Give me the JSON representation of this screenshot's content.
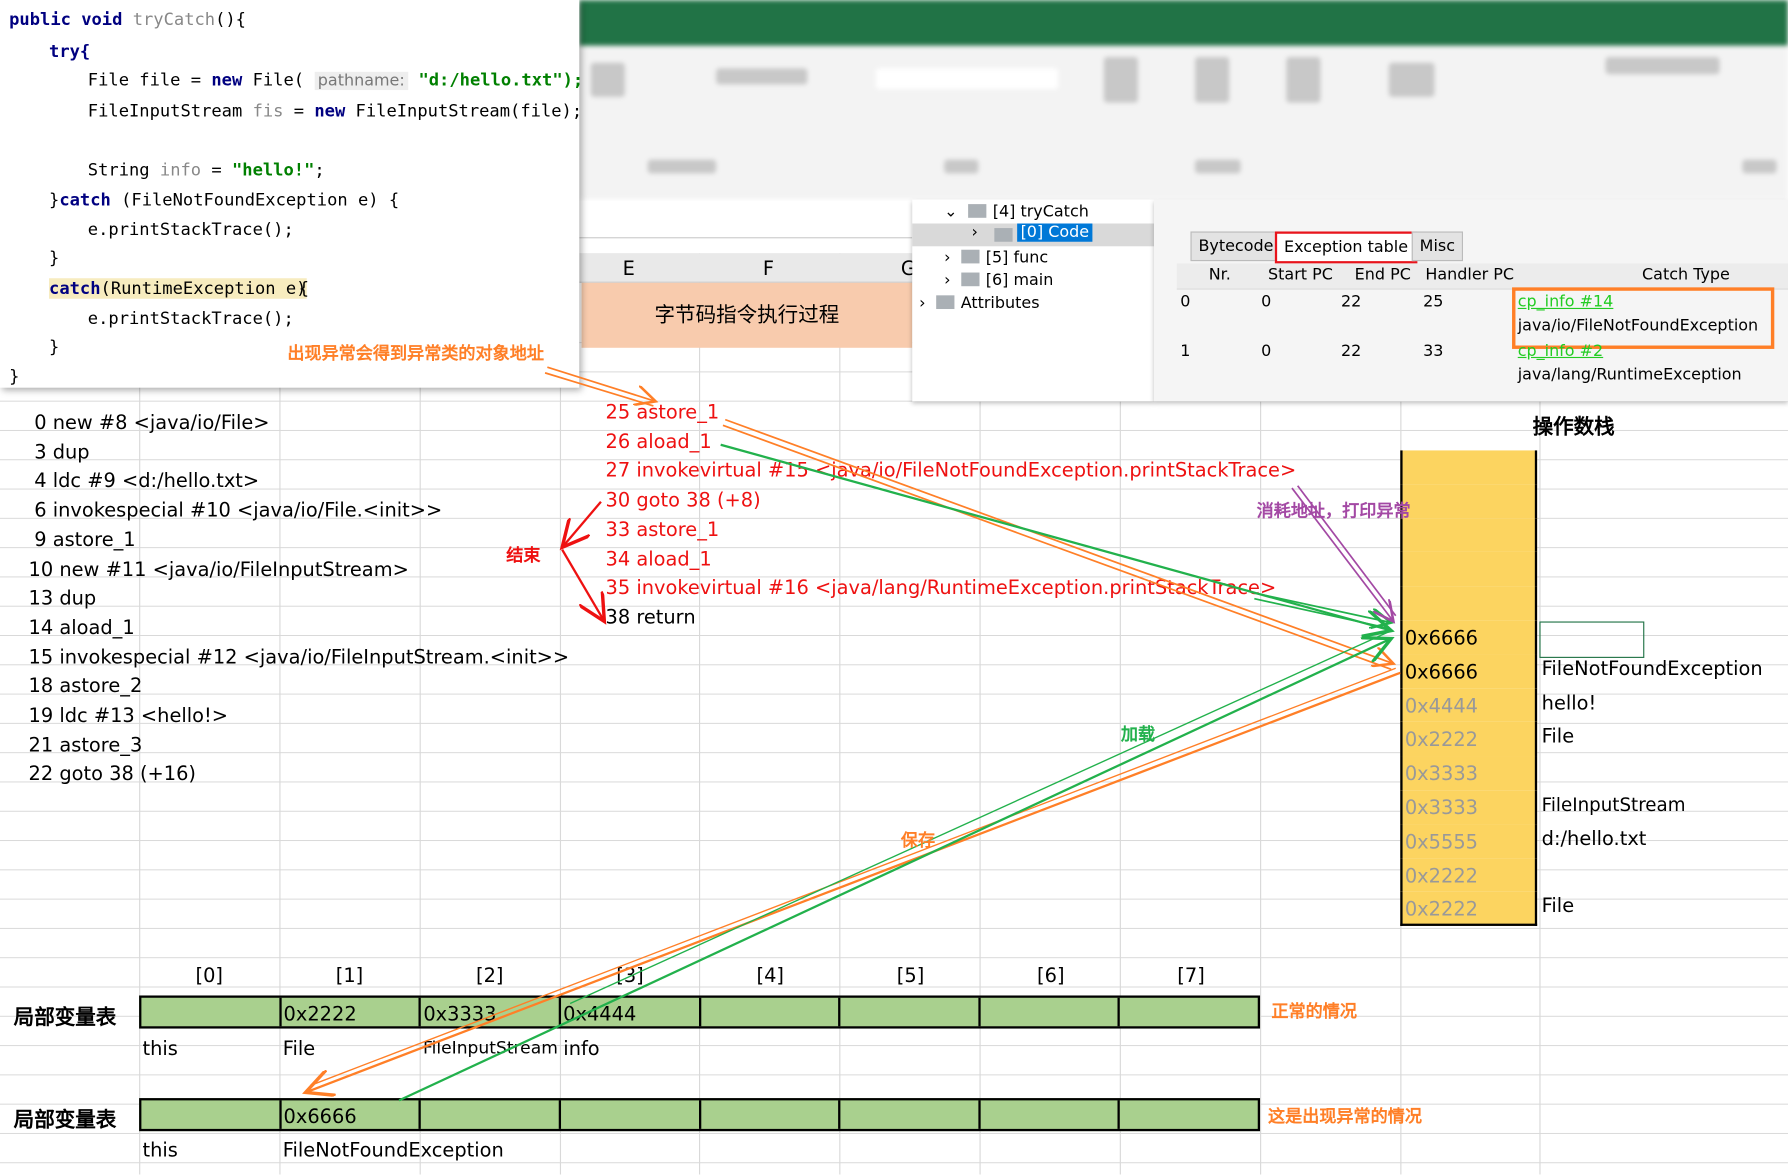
{
  "code": {
    "lines": [
      "public void tryCatch(){",
      "try{",
      "File file = new File(",
      "pathname:",
      "\"d:/hello.txt\");",
      "FileInputStream fis = new FileInputStream(file);",
      "String info = \"hello!\";",
      "}catch (FileNotFoundException e) {",
      "e.printStackTrace();",
      "}",
      "catch(RuntimeException e){",
      "e.printStackTrace();",
      "}",
      "}"
    ],
    "annotation": "出现异常会得到异常类的对象地址"
  },
  "sheet": {
    "columns": [
      "E",
      "F",
      "G"
    ],
    "title_cell": "字节码指令执行过程"
  },
  "tree": {
    "items": [
      "[4] tryCatch",
      "[0] Code",
      "[5] func",
      "[6] main",
      "Attributes"
    ]
  },
  "exception_table": {
    "tabs": [
      "Bytecode",
      "Exception table",
      "Misc"
    ],
    "headers": [
      "Nr.",
      "Start PC",
      "End PC",
      "Handler PC",
      "Catch Type"
    ],
    "rows": [
      {
        "nr": "0",
        "start": "0",
        "end": "22",
        "handler": "25",
        "link": "cp_info #14",
        "type": "java/io/FileNotFoundException"
      },
      {
        "nr": "1",
        "start": "0",
        "end": "22",
        "handler": "33",
        "link": "cp_info #2",
        "type": "java/lang/RuntimeException"
      }
    ]
  },
  "bytecode": [
    "0 new #8 <java/io/File>",
    "3 dup",
    "4 ldc #9 <d:/hello.txt>",
    "6 invokespecial #10 <java/io/File.<init>>",
    "9 astore_1",
    "10 new #11 <java/io/FileInputStream>",
    "13 dup",
    "14 aload_1",
    "15 invokespecial #12 <java/io/FileInputStream.<init>>",
    "18 astore_2",
    "19 ldc #13 <hello!>",
    "21 astore_3",
    "22 goto 38 (+16)"
  ],
  "handler_bytecode": [
    "25 astore_1",
    "26 aload_1",
    "27 invokevirtual #15 <java/io/FileNotFoundException.printStackTrace>",
    "30 goto 38 (+8)",
    "33 astore_1",
    "34 aload_1",
    "35 invokevirtual #16 <java/lang/RuntimeException.printStackTrace>",
    "38 return"
  ],
  "operand_stack": {
    "title": "操作数栈",
    "cells": [
      {
        "value": "",
        "label": ""
      },
      {
        "value": "",
        "label": ""
      },
      {
        "value": "",
        "label": ""
      },
      {
        "value": "",
        "label": ""
      },
      {
        "value": "",
        "label": ""
      },
      {
        "value": "0x6666",
        "label": ""
      },
      {
        "value": "0x6666",
        "label": "FileNotFoundException"
      },
      {
        "value": "0x4444",
        "label": "hello!"
      },
      {
        "value": "0x2222",
        "label": "File"
      },
      {
        "value": "0x3333",
        "label": ""
      },
      {
        "value": "0x3333",
        "label": "FileInputStream"
      },
      {
        "value": "0x5555",
        "label": "d:/hello.txt"
      },
      {
        "value": "0x2222",
        "label": ""
      },
      {
        "value": "0x2222",
        "label": "File"
      }
    ]
  },
  "locals": {
    "title": "局部变量表",
    "indices": [
      "[0]",
      "[1]",
      "[2]",
      "[3]",
      "[4]",
      "[5]",
      "[6]",
      "[7]"
    ],
    "normal": {
      "values": [
        "",
        "0x2222",
        "0x3333",
        "0x4444",
        "",
        "",
        "",
        ""
      ],
      "labels": [
        "this",
        "File",
        "FileInputStream",
        "info"
      ],
      "note": "正常的情况"
    },
    "exception": {
      "values": [
        "",
        "0x6666",
        "",
        "",
        "",
        "",
        "",
        ""
      ],
      "labels": [
        "this",
        "FileNotFoundException"
      ],
      "note": "这是出现异常的情况"
    }
  },
  "annotations": {
    "end": "结束",
    "consume": "消耗地址，打印异常",
    "load": "加载",
    "save": "保存"
  },
  "colors": {
    "excel_green": "#217346",
    "stack_yellow": "#fcd460",
    "locals_green": "#a9d08e",
    "orange": "#ff7f27",
    "red": "#ee1111",
    "green_arrow": "#22b14c",
    "purple": "#a349a4"
  }
}
